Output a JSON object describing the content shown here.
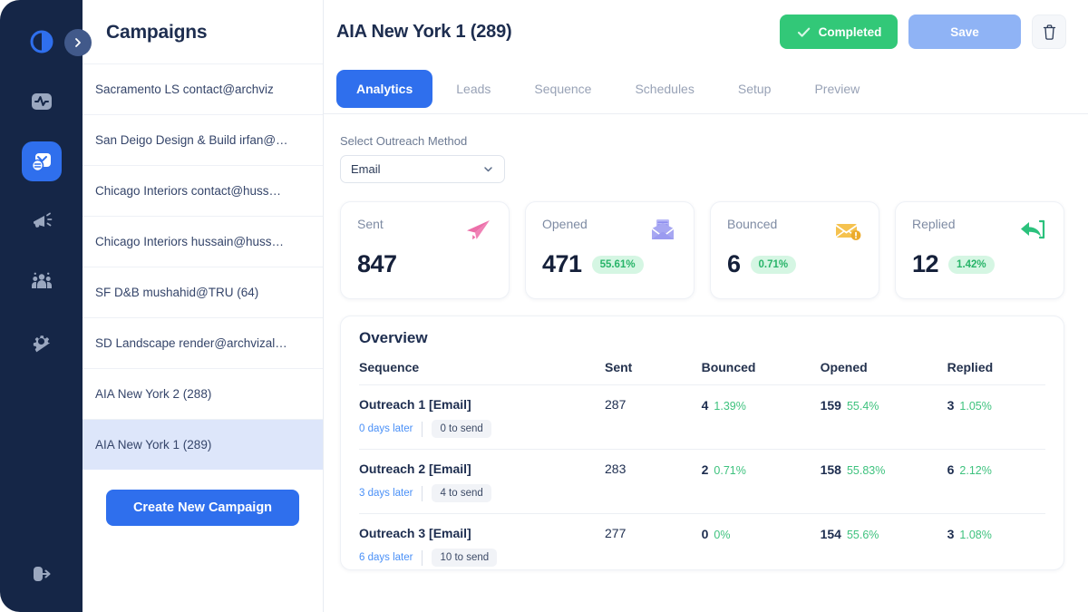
{
  "rail": {
    "logo_icon": "half-moon-logo-icon",
    "collapse_icon": "chevron-right-icon",
    "items": [
      {
        "name": "analytics",
        "icon": "activity-monitor-icon",
        "active": false
      },
      {
        "name": "campaigns",
        "icon": "mail-contact-icon",
        "active": true
      },
      {
        "name": "announcements",
        "icon": "megaphone-icon",
        "active": false
      },
      {
        "name": "audience",
        "icon": "people-group-icon",
        "active": false
      },
      {
        "name": "settings",
        "icon": "gear-icon",
        "active": false
      }
    ],
    "logout_icon": "logout-icon"
  },
  "sidebar": {
    "title": "Campaigns",
    "create_button": "Create New Campaign",
    "items": [
      {
        "label": "Sacramento LS contact@archviz",
        "selected": false
      },
      {
        "label": "San Deigo Design & Build irfan@…",
        "selected": false
      },
      {
        "label": "Chicago Interiors contact@huss…",
        "selected": false
      },
      {
        "label": "Chicago Interiors hussain@huss…",
        "selected": false
      },
      {
        "label": "SF D&B mushahid@TRU (64)",
        "selected": false
      },
      {
        "label": "SD Landscape render@archvizal…",
        "selected": false
      },
      {
        "label": "AIA New York 2 (288)",
        "selected": false
      },
      {
        "label": "AIA New York 1 (289)",
        "selected": true
      }
    ]
  },
  "header": {
    "title": "AIA New York 1 (289)",
    "status_button": "Completed",
    "status_icon": "check-icon",
    "save_button": "Save",
    "delete_icon": "trash-icon"
  },
  "tabs": [
    {
      "label": "Analytics",
      "active": true
    },
    {
      "label": "Leads",
      "active": false
    },
    {
      "label": "Sequence",
      "active": false
    },
    {
      "label": "Schedules",
      "active": false
    },
    {
      "label": "Setup",
      "active": false
    },
    {
      "label": "Preview",
      "active": false
    }
  ],
  "outreach": {
    "label": "Select Outreach Method",
    "selected": "Email",
    "options": [
      "Email"
    ],
    "chevron_icon": "chevron-down-icon"
  },
  "stats": [
    {
      "label": "Sent",
      "value": "847",
      "pct": "",
      "icon": "paper-plane-icon",
      "color": "#ec6fa9"
    },
    {
      "label": "Opened",
      "value": "471",
      "pct": "55.61%",
      "icon": "open-envelope-icon",
      "color": "#9b9bf0"
    },
    {
      "label": "Bounced",
      "value": "6",
      "pct": "0.71%",
      "icon": "envelope-alert-icon",
      "color": "#f5bd3f"
    },
    {
      "label": "Replied",
      "value": "12",
      "pct": "1.42%",
      "icon": "reply-arrow-icon",
      "color": "#2bc17c"
    }
  ],
  "overview": {
    "title": "Overview",
    "columns": [
      "Sequence",
      "Sent",
      "Bounced",
      "Opened",
      "Replied"
    ],
    "rows": [
      {
        "sequence": "Outreach 1 [Email]",
        "days": "0 days later",
        "to_send": "0 to send",
        "sent": "287",
        "bounced": "4",
        "bounced_pct": "1.39%",
        "opened": "159",
        "opened_pct": "55.4%",
        "replied": "3",
        "replied_pct": "1.05%"
      },
      {
        "sequence": "Outreach 2 [Email]",
        "days": "3 days later",
        "to_send": "4 to send",
        "sent": "283",
        "bounced": "2",
        "bounced_pct": "0.71%",
        "opened": "158",
        "opened_pct": "55.83%",
        "replied": "6",
        "replied_pct": "2.12%"
      },
      {
        "sequence": "Outreach 3 [Email]",
        "days": "6 days later",
        "to_send": "10 to send",
        "sent": "277",
        "bounced": "0",
        "bounced_pct": "0%",
        "opened": "154",
        "opened_pct": "55.6%",
        "replied": "3",
        "replied_pct": "1.08%"
      }
    ]
  },
  "colors": {
    "rail_bg": "#152647",
    "accent_blue": "#2f6fed",
    "success_green": "#32c878",
    "save_blue": "#8fb3f5",
    "selected_row": "#dde6fa"
  }
}
